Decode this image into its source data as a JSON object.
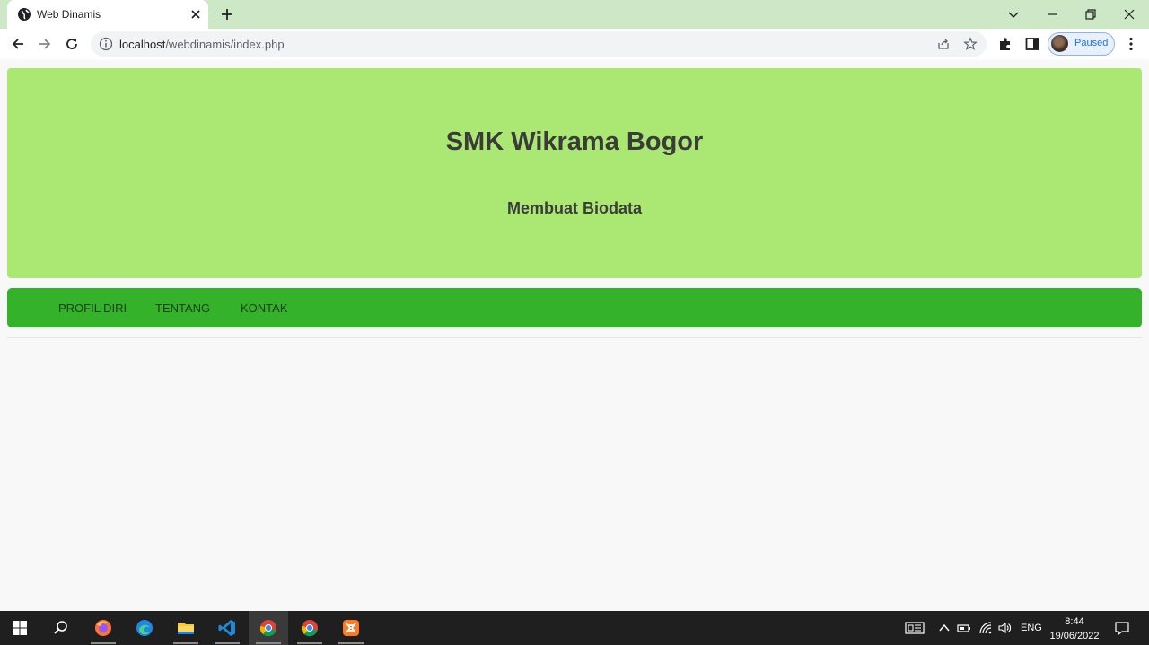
{
  "browser": {
    "tab": {
      "title": "Web Dinamis",
      "favicon": "globe-icon"
    },
    "address": {
      "host": "localhost",
      "path": "/webdinamis/index.php"
    },
    "profile": {
      "status": "Paused"
    }
  },
  "page": {
    "title": "SMK Wikrama Bogor",
    "subtitle": "Membuat Biodata",
    "nav": [
      "PROFIL DIRI",
      "TENTANG",
      "KONTAK"
    ]
  },
  "taskbar": {
    "apps": [
      "windows-start-icon",
      "search-icon",
      "firefox-icon",
      "edge-icon",
      "file-explorer-icon",
      "vscode-icon",
      "chrome-icon",
      "chrome-icon",
      "xampp-icon"
    ],
    "language": "ENG",
    "time": "8:44",
    "date": "19/06/2022"
  },
  "colors": {
    "header_bg": "#abe873",
    "nav_bg": "#34b32a",
    "tabstrip_bg": "#cde8c6"
  }
}
